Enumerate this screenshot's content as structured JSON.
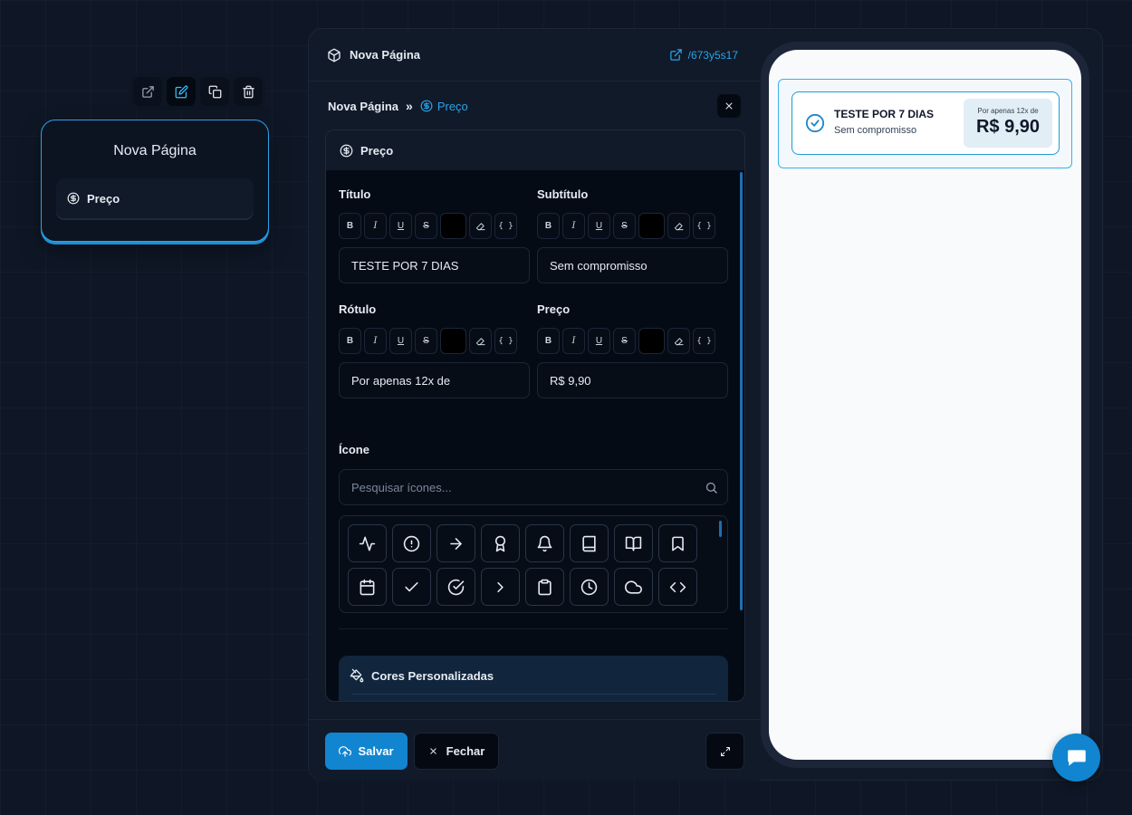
{
  "node": {
    "title": "Nova Página",
    "item_label": "Preço",
    "toolbar": [
      "external-link-icon",
      "edit-icon",
      "copy-icon",
      "trash-icon"
    ]
  },
  "panel": {
    "header_title": "Nova Página",
    "header_link": "/673y5s17",
    "breadcrumb": {
      "root": "Nova Página",
      "separator": "»",
      "current": "Preço"
    },
    "section_title": "Preço",
    "fields": {
      "titulo": {
        "label": "Título",
        "value": "TESTE POR 7 DIAS"
      },
      "subtitulo": {
        "label": "Subtítulo",
        "value": "Sem compromisso"
      },
      "rotulo": {
        "label": "Rótulo",
        "value": "Por apenas 12x de"
      },
      "preco": {
        "label": "Preço",
        "value": "R$ 9,90"
      }
    },
    "format_buttons": {
      "bold": "B",
      "italic": "I",
      "underline": "U",
      "strike": "S",
      "code": "{ }"
    },
    "icon_section": {
      "label": "Ícone",
      "search_placeholder": "Pesquisar ícones...",
      "icons": [
        "activity-icon",
        "alert-circle-icon",
        "arrow-right-icon",
        "award-icon",
        "bell-icon",
        "book-icon",
        "book-open-icon",
        "bookmark-icon",
        "calendar-icon",
        "check-icon",
        "check-circle-icon",
        "chevron-right-icon",
        "clipboard-icon",
        "clock-icon",
        "cloud-icon",
        "code-icon"
      ]
    },
    "custom_colors_title": "Cores Personalizadas",
    "footer": {
      "save_label": "Salvar",
      "close_label": "Fechar"
    }
  },
  "preview": {
    "title": "TESTE POR 7 DIAS",
    "subtitle": "Sem compromisso",
    "price_label": "Por apenas 12x de",
    "price": "R$ 9,90"
  },
  "colors": {
    "accent": "#1285d0",
    "link": "#2aa3e8",
    "background": "#0f1726"
  }
}
